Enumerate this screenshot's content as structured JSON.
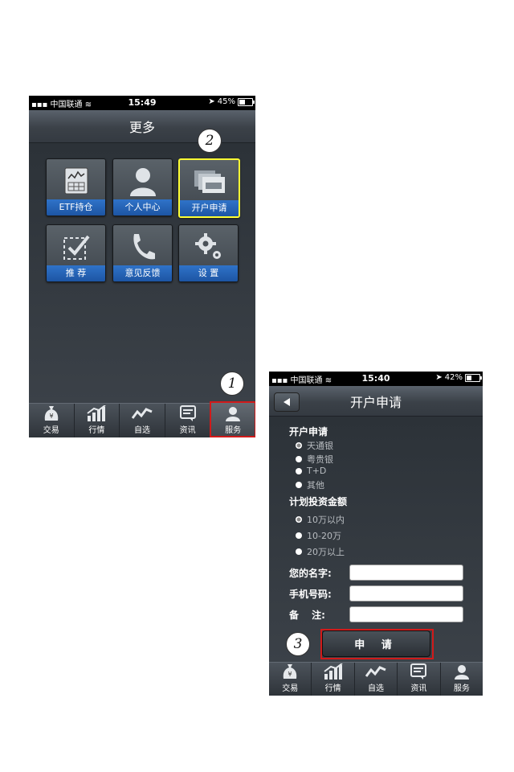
{
  "phone1": {
    "status": {
      "carrier": "中国联通",
      "time": "15:49",
      "battery": "45%"
    },
    "title": "更多",
    "tiles": [
      {
        "label": "ETF持仓",
        "icon": "chart-document-icon"
      },
      {
        "label": "个人中心",
        "icon": "person-icon"
      },
      {
        "label": "开户申请",
        "icon": "cards-icon",
        "selected": true
      },
      {
        "label": "推 荐",
        "icon": "check-box-icon"
      },
      {
        "label": "意见反馈",
        "icon": "phone-icon"
      },
      {
        "label": "设 置",
        "icon": "gears-icon"
      }
    ],
    "tabs": [
      {
        "label": "交易",
        "icon": "money-bag-icon"
      },
      {
        "label": "行情",
        "icon": "bar-trend-icon"
      },
      {
        "label": "自选",
        "icon": "trend-line-icon"
      },
      {
        "label": "资讯",
        "icon": "news-icon"
      },
      {
        "label": "服务",
        "icon": "service-person-icon",
        "active": true
      }
    ],
    "callouts": [
      "2",
      "1"
    ]
  },
  "phone2": {
    "status": {
      "carrier": "中国联通",
      "time": "15:40",
      "battery": "42%"
    },
    "title": "开户申请",
    "account_section": {
      "heading": "开户申请",
      "options": [
        "天通银",
        "粤贵银",
        "T+D",
        "其他"
      ],
      "selected": "天通银"
    },
    "amount_section": {
      "heading": "计划投资金额",
      "options": [
        "10万以内",
        "10-20万",
        "20万以上"
      ],
      "selected": "10万以内"
    },
    "fields": [
      {
        "label": "您的名字:",
        "value": ""
      },
      {
        "label": "手机号码:",
        "value": ""
      },
      {
        "label": "备　 注:",
        "value": ""
      }
    ],
    "submit_label": "申 请",
    "tabs": [
      {
        "label": "交易",
        "icon": "money-bag-icon"
      },
      {
        "label": "行情",
        "icon": "bar-trend-icon"
      },
      {
        "label": "自选",
        "icon": "trend-line-icon"
      },
      {
        "label": "资讯",
        "icon": "news-icon"
      },
      {
        "label": "服务",
        "icon": "service-person-icon"
      }
    ],
    "callouts": [
      "3"
    ]
  },
  "colors": {
    "accent_blue": "#1f5cb0",
    "highlight_yellow": "#ffff33",
    "callout_red": "#d11a1a"
  }
}
